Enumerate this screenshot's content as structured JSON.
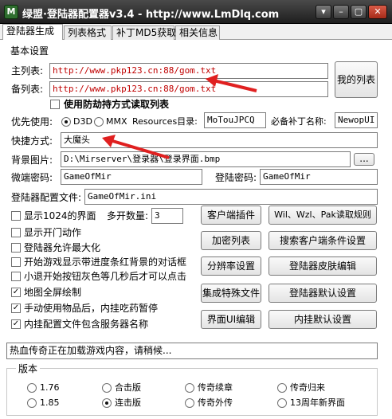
{
  "window": {
    "title": "绿盟·登陆器配置器v3.4 - http://www.LmDlq.com",
    "icon_name": "app-logo-icon",
    "icon_text": "M",
    "controls": [
      "▾",
      "–",
      "▢",
      "✕"
    ]
  },
  "tabs": [
    {
      "label": "登陆器生成",
      "active": true
    },
    {
      "label": "列表格式",
      "active": false
    },
    {
      "label": "补丁MD5获取",
      "active": false
    },
    {
      "label": "相关信息",
      "active": false
    }
  ],
  "basic": {
    "section_label": "基本设置",
    "main_list_label": "主列表:",
    "main_list_value": "http://www.pkp123.cn:88/gom.txt",
    "backup_list_label": "备列表:",
    "backup_list_value": "http://www.pkp123.cn:88/gom.txt",
    "my_list_button": "我的列表",
    "anti_hijack_label": "使用防劫持方式读取列表",
    "anti_hijack_checked": false
  },
  "priority": {
    "label": "优先使用:",
    "options": [
      {
        "label": "D3D",
        "selected": true
      },
      {
        "label": "MMX",
        "selected": false
      }
    ],
    "resources_label": "Resources目录:",
    "resources_value": "MoTouJPCQ",
    "patch_label": "必备补丁名称:",
    "patch_value": "NewopUI"
  },
  "shortcut": {
    "label": "快捷方式:",
    "value": "大魔头"
  },
  "background": {
    "label": "背景图片:",
    "value": "D:\\Mirserver\\登录器\\登录界面.bmp",
    "browse_label": "..."
  },
  "credentials": {
    "micro_label": "微端密码:",
    "micro_value": "GameOfMir",
    "login_label": "登陆密码:",
    "login_value": "GameOfMir"
  },
  "config_file": {
    "label": "登陆器配置文件:",
    "value": "GameOfMir.ini"
  },
  "options": [
    {
      "label": "显示1024的界面",
      "checked": false
    },
    {
      "label": "显示开门动作",
      "checked": false
    },
    {
      "label": "登陆器允许最大化",
      "checked": false
    },
    {
      "label": "开始游戏显示带进度条红背景的对话框",
      "checked": false
    },
    {
      "label": "小退开始按钮灰色等几秒后才可以点击",
      "checked": false
    },
    {
      "label": "地图全屏绘制",
      "checked": true
    },
    {
      "label": "手动使用物品后，内挂吃药暂停",
      "checked": true
    },
    {
      "label": "内挂配置文件包含服务器名称",
      "checked": true
    }
  ],
  "multi_open": {
    "label": "多开数量:",
    "value": "3"
  },
  "actions": {
    "client_plugin": "客户端插件",
    "wil_wzl": "Wil、Wzl、Pak读取规则",
    "encrypt_list": "加密列表",
    "search_client": "搜索客户端条件设置",
    "resolution": "分辨率设置",
    "skin_edit": "登陆器皮肤编辑",
    "special_files": "集成特殊文件",
    "default_settings": "登陆器默认设置",
    "ui_edit": "界面UI编辑",
    "plugin_defaults": "内挂默认设置"
  },
  "status": {
    "text": "热血传奇正在加载游戏内容，请稍候..."
  },
  "version": {
    "label": "版本",
    "options": [
      {
        "label": "1.76",
        "selected": false
      },
      {
        "label": "合击版",
        "selected": false
      },
      {
        "label": "传奇续章",
        "selected": false
      },
      {
        "label": "传奇归来",
        "selected": false
      },
      {
        "label": "1.85",
        "selected": false
      },
      {
        "label": "连击版",
        "selected": true
      },
      {
        "label": "传奇外传",
        "selected": false
      },
      {
        "label": "13周年新界面",
        "selected": false
      }
    ]
  },
  "colors": {
    "arrow": "#e02020",
    "url_text": "#c00000",
    "title_bar": "#2b2b2b"
  }
}
